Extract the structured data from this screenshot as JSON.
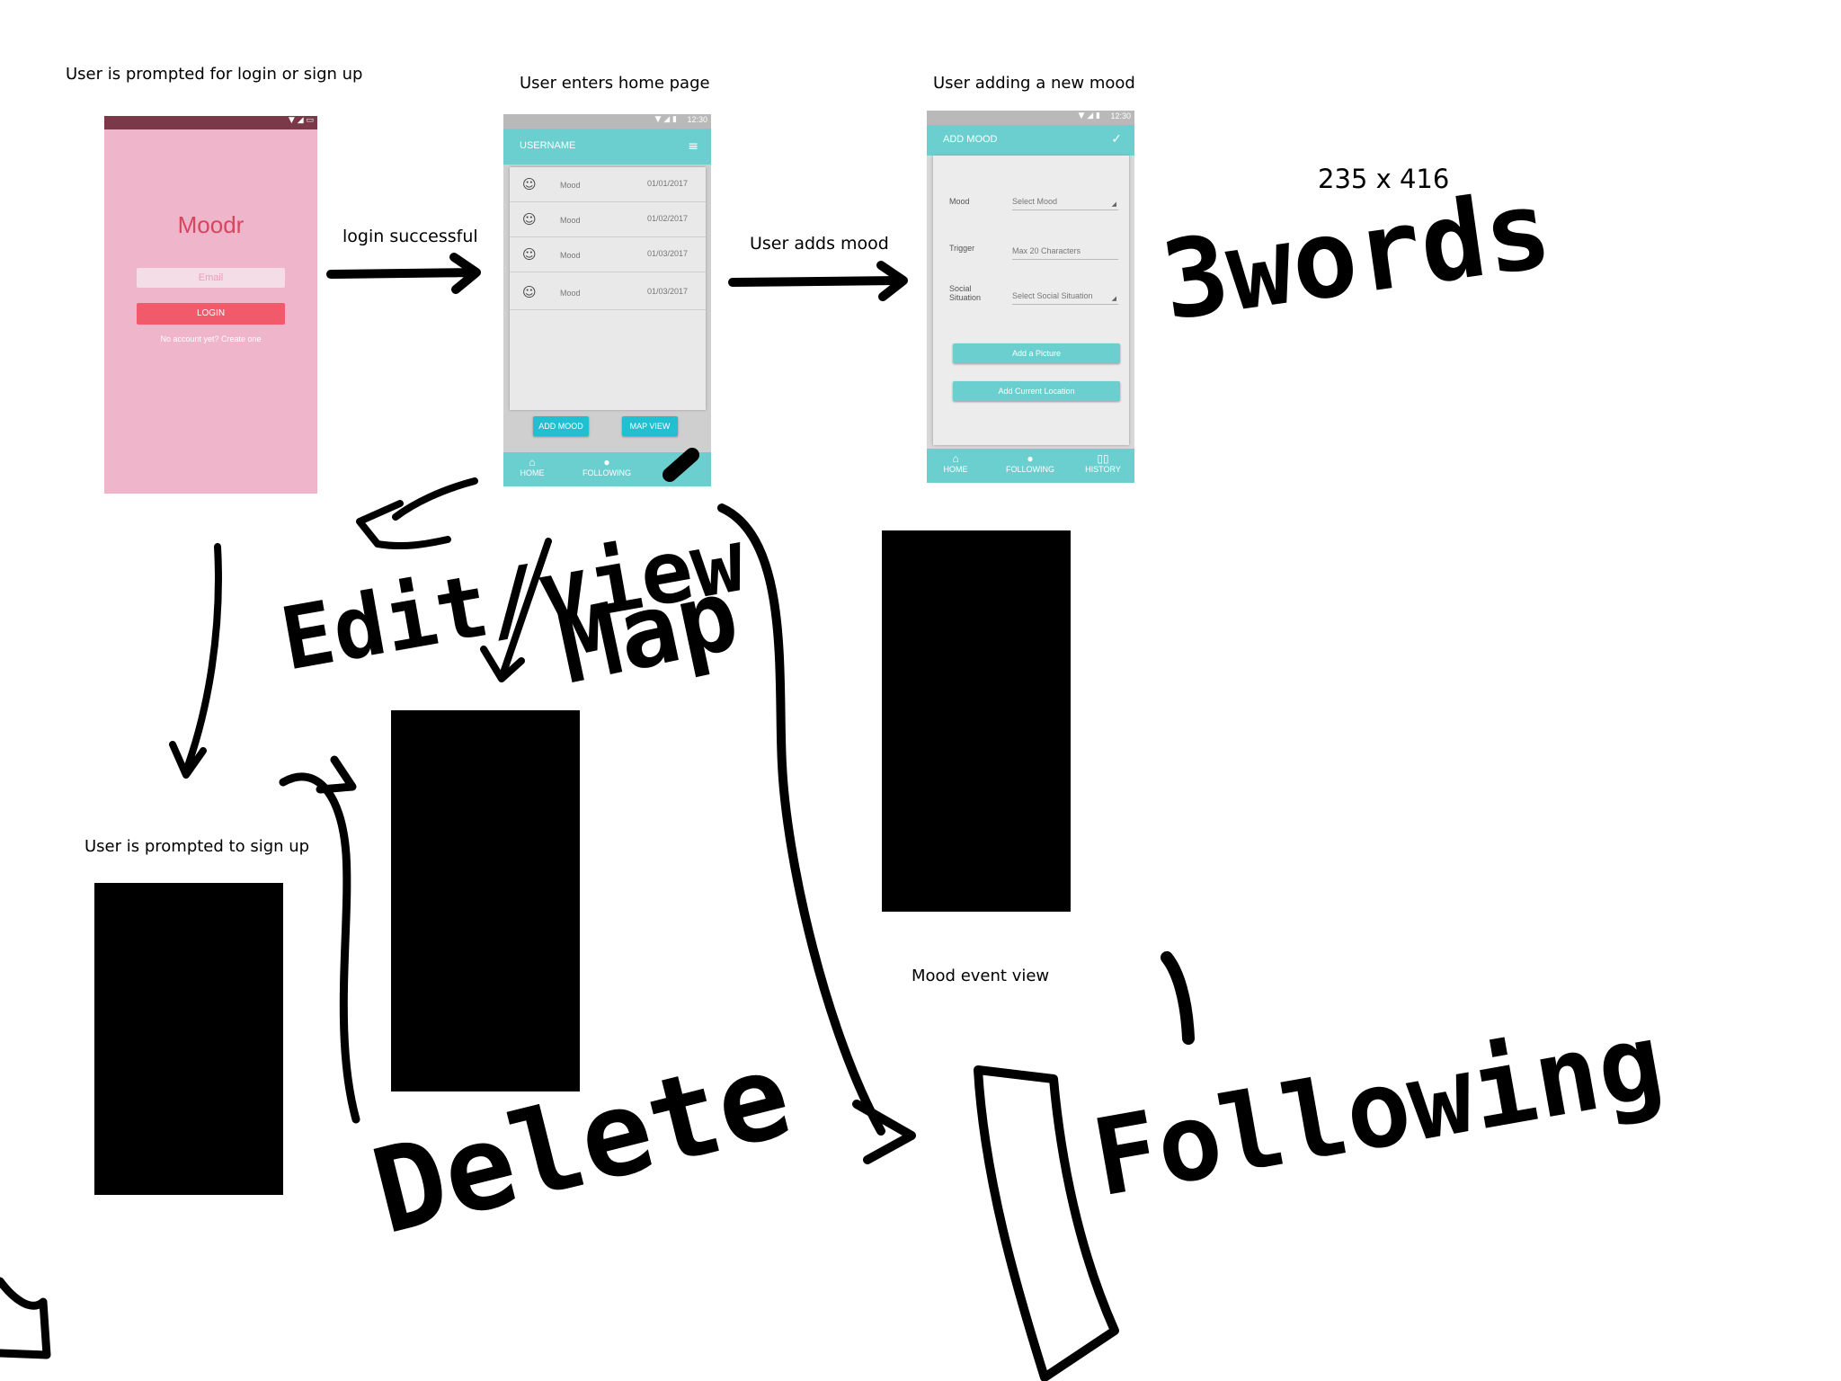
{
  "captions": {
    "login_screen": "User is prompted for login or sign up",
    "home_screen": "User enters home page",
    "add_mood_screen": "User adding a new mood",
    "signup_screen": "User is prompted to sign up",
    "mood_event_view": "Mood event view"
  },
  "flow_labels": {
    "login_successful": "login successful",
    "user_adds_mood": "User adds mood"
  },
  "dimensions_note": "235 x 416",
  "handwritten": {
    "three_words": "3words",
    "edit_view": "Edit/view",
    "map": "Map",
    "delete": "Delete",
    "following": "Following"
  },
  "login_phone": {
    "app_name": "Moodr",
    "email_placeholder": "Email",
    "login_button": "LOGIN",
    "create_account_link": "No account yet? Create one"
  },
  "home_phone": {
    "status_time": "12:30",
    "header_title": "USERNAME",
    "moods": [
      {
        "label": "Mood",
        "date": "01/01/2017"
      },
      {
        "label": "Mood",
        "date": "01/02/2017"
      },
      {
        "label": "Mood",
        "date": "01/03/2017"
      },
      {
        "label": "Mood",
        "date": "01/03/2017"
      }
    ],
    "add_mood_button": "ADD MOOD",
    "map_view_button": "MAP VIEW",
    "nav": {
      "home": "HOME",
      "following": "FOLLOWING",
      "history": "ORY"
    }
  },
  "add_mood_phone": {
    "status_time": "12:30",
    "header_title": "ADD MOOD",
    "fields": {
      "mood_label": "Mood",
      "mood_value": "Select Mood",
      "trigger_label": "Trigger",
      "trigger_value": "Max 20 Characters",
      "social_label_line1": "Social",
      "social_label_line2": "Situation",
      "social_value": "Select Social Situation"
    },
    "add_picture_button": "Add a Picture",
    "add_location_button": "Add Current Location",
    "nav": {
      "home": "HOME",
      "following": "FOLLOWING",
      "history": "HISTORY"
    }
  },
  "colors": {
    "login_bg": "#efb5cb",
    "login_status_bar": "#7b3848",
    "login_button": "#f05a6a",
    "teal": "#6ccfcf",
    "cyan_button": "#22bfd0",
    "ink": "#000000"
  }
}
